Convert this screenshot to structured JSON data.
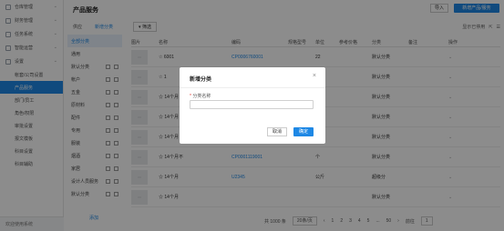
{
  "sidebar": {
    "items": [
      {
        "label": "仓库管理",
        "icon": "warehouse-icon"
      },
      {
        "label": "财务管理",
        "icon": "finance-icon"
      },
      {
        "label": "任务系统",
        "icon": "task-icon"
      },
      {
        "label": "智能运营",
        "icon": "operation-icon"
      },
      {
        "label": "设置",
        "icon": "gear-icon"
      }
    ],
    "subitems": [
      {
        "label": "帐套/公司设置"
      },
      {
        "label": "产品服务",
        "active": true
      },
      {
        "label": "部门/员工"
      },
      {
        "label": "角色/权限"
      },
      {
        "label": "审批设置"
      },
      {
        "label": "报文模板"
      },
      {
        "label": "科目设置"
      },
      {
        "label": "科目辅助"
      }
    ],
    "footer": "欢迎使用系统"
  },
  "header": {
    "title": "产品服务",
    "import_label": "导入",
    "add_product_label": "新增产品/服务"
  },
  "tabs": [
    {
      "label": "供应"
    },
    {
      "label": "新增分类",
      "active": true
    }
  ],
  "filter_label": "筛选",
  "toolbar_right": "显示已停用",
  "categories": {
    "items": [
      "全部分类",
      "通用",
      "默认分类",
      "帐户",
      "五金",
      "原材料",
      "配件",
      "专用",
      "服装",
      "烟酒",
      "家居",
      "设计人员服务",
      "默认分类"
    ],
    "footer": "添加"
  },
  "table": {
    "columns": [
      "图片",
      "名称",
      "编码",
      "规格型号",
      "单位",
      "参考价格",
      "分类",
      "备注",
      "操作"
    ],
    "rows": [
      {
        "name": "☆ 6001",
        "code": "CP0006760001",
        "unit": "22",
        "category": "默认分类"
      },
      {
        "name": "☆ 1",
        "code": "",
        "unit": "",
        "category": "默认分类"
      },
      {
        "name": "☆ 14个月",
        "code": "",
        "unit": "",
        "category": "默认分类"
      },
      {
        "name": "☆ 14个月",
        "code": "",
        "unit": "",
        "category": "默认分类"
      },
      {
        "name": "☆ 14个月",
        "code": "",
        "unit": "",
        "category": "默认分类"
      },
      {
        "name": "☆ 14个月不",
        "code": "CP0001119001",
        "unit": "个",
        "category": "默认分类"
      },
      {
        "name": "☆ 14个月",
        "code": "U2345",
        "unit": "公斤",
        "category": "超级分"
      },
      {
        "name": "☆ 14个月",
        "code": "",
        "unit": "",
        "category": "默认分类"
      }
    ]
  },
  "pager": {
    "total": "共 1000 条",
    "per_page": "20条/页",
    "pages": [
      "1",
      "2",
      "3",
      "4",
      "5",
      "...",
      "50"
    ],
    "goto": "前往",
    "page_input": "1"
  },
  "modal": {
    "title": "新增分类",
    "field_label": "分类名称",
    "field_value": "",
    "cancel_label": "取消",
    "ok_label": "确定"
  }
}
